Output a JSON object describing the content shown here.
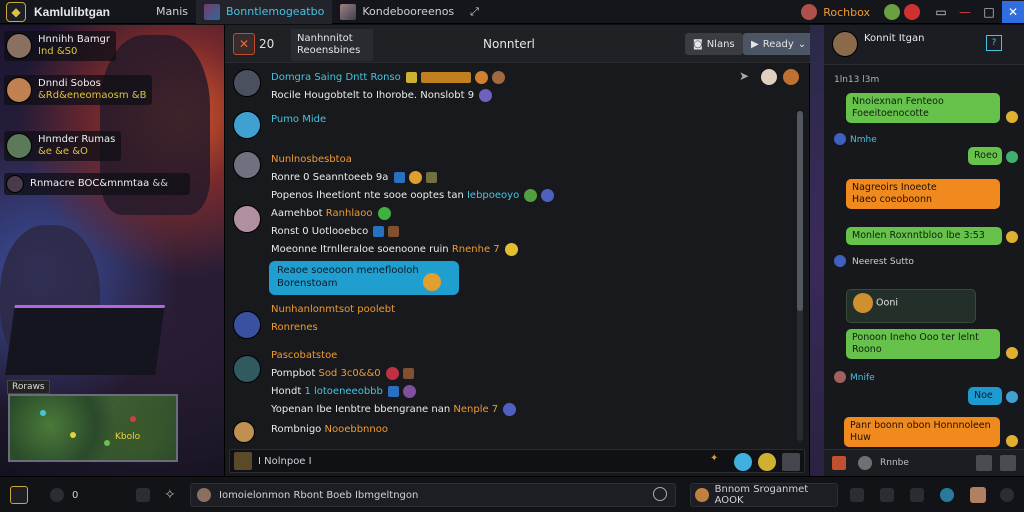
{
  "titlebar": {
    "app_title": "Kamlulibtgan",
    "tabs": [
      "Manis",
      "Bonntlemogeatbo",
      "Kondebooreenos"
    ],
    "right_label": "Rochbox",
    "close_glyph": "✕"
  },
  "friends": [
    {
      "name": "Hnnihh Bamgr",
      "status": "Ind &S0"
    },
    {
      "name": "Dnndi Sobos",
      "status": "&Rd&eneomaosm &B"
    },
    {
      "name": "Hnmder Rumas",
      "status": "&e &e &O"
    },
    {
      "name": "Rnmacre BOC&mnmtaa",
      "status": "&&"
    }
  ],
  "minimap": {
    "tag": "Roraws",
    "label": "Kbolo"
  },
  "chat": {
    "header_icon_label": "20",
    "header_box_line1": "Nanhnnitot",
    "header_box_line2": "Reoensbines",
    "header_title": "Nonnterl",
    "btn1": "Nlans",
    "btn2": "Ready",
    "messages": [
      {
        "lines": [
          [
            "Domgra Saing",
            "n-cyan"
          ],
          [
            "Rocile Hougobtelt to Ihorobe. Nonslobt 9",
            "n-white"
          ]
        ],
        "tag": "Dntt Ronso"
      },
      {
        "lines": [
          [
            "Pumo Mide",
            "n-cyan"
          ]
        ]
      },
      {
        "lines": [
          [
            "Nunlnosbesbtoa",
            "n-orange"
          ],
          [
            "Ronre 0 Seanntoeeb 9a",
            "n-white"
          ],
          [
            "Popenos Iheetiont nte sooe ooptes tan",
            "n-white"
          ]
        ],
        "tail": "Iebpoeoyo"
      },
      {
        "lines": [
          [
            "Aamehbot",
            "n-white"
          ],
          [
            "Ronst 0 Uotlooebco",
            "n-white"
          ],
          [
            "Moeonne Itrnlleraloe soenoone ruin",
            "n-white"
          ]
        ],
        "tag": "Ranhlaoo",
        "tail": "Rnenhe 7"
      },
      {
        "lines": [
          [
            "Nunhanlonmtsot poolebt",
            "n-orange"
          ],
          [
            "Ronrenes",
            "n-orange"
          ]
        ]
      },
      {
        "lines": [
          [
            "Pascobatstoe",
            "n-orange"
          ],
          [
            "Pompbot",
            "n-white"
          ],
          [
            "Hondt",
            "n-white"
          ],
          [
            "Yopenan Ibe Ienbtre bbengrane nan",
            "n-white"
          ]
        ],
        "tag": "Sod 3c0&&0",
        "mid": "1 lotoeneeobbb",
        "tail": "Nenple 7"
      },
      {
        "lines": [
          [
            "Rombnigo",
            "n-white"
          ]
        ],
        "tag": "Nooebbnnoo"
      }
    ],
    "bubble_line1": "Reaoe soeooon meneflooloh",
    "bubble_line2": "Borenstoam",
    "input_text": "I Nolnpoe I"
  },
  "mobile": {
    "name": "Konnit Itgan",
    "sub": "1ln13 l3m",
    "bubble1": "Nnoiexnan Fenteoo\nFoeeitoenocotte",
    "name2": "Nmhe",
    "bubble2": "Roeo",
    "bubble3": "Nagreoirs Inoeote\nHaeo coeoboonn",
    "bubble4": "Monlen Roxnntbloo lbe 3:53",
    "name3": "Neerest Sutto",
    "dark_title": "Ooni",
    "bubble5": "Ponoon Ineho Ooo ter lelnt\nRoono",
    "name4": "Mnife",
    "bubble6": "Noe",
    "bubble7": "Panr boonn obon Honnnoleen\nHuw",
    "footer": "Rnnbe"
  },
  "bottombar": {
    "count": "0",
    "search_text": "Iomoielonmon Rbont Boeb Ibmgeltngon",
    "search2_text": "Bnnom Sroganmet AOOK"
  },
  "colors": {
    "accent": "#46c3e0",
    "orange": "#f29a2e",
    "green": "#66c24a",
    "bg": "#18191d"
  }
}
